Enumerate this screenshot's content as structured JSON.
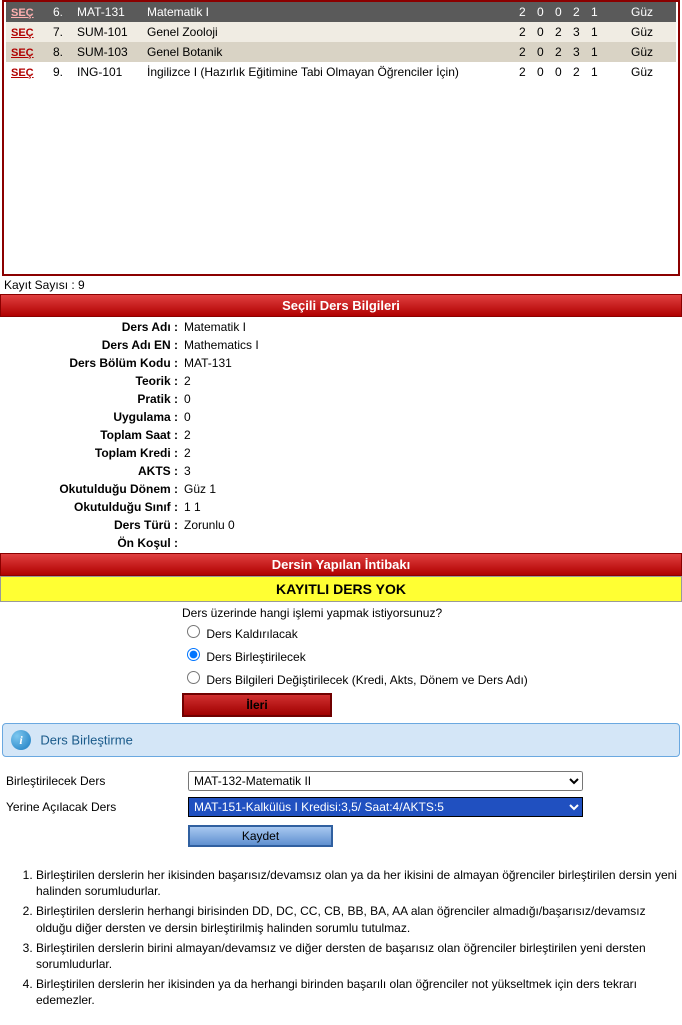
{
  "table": {
    "sel_label": "SEÇ",
    "header": {
      "no": "6.",
      "code": "MAT-131",
      "name": "Matematik I",
      "c1": "2",
      "c2": "0",
      "c3": "0",
      "c4": "2",
      "c5": "1",
      "term": "Güz"
    },
    "rows": [
      {
        "no": "7.",
        "code": "SUM-101",
        "name": "Genel Zooloji",
        "c1": "2",
        "c2": "0",
        "c3": "2",
        "c4": "3",
        "c5": "1",
        "term": "Güz",
        "cls": "row-light"
      },
      {
        "no": "8.",
        "code": "SUM-103",
        "name": "Genel Botanik",
        "c1": "2",
        "c2": "0",
        "c3": "2",
        "c4": "3",
        "c5": "1",
        "term": "Güz",
        "cls": "row-dark"
      },
      {
        "no": "9.",
        "code": "ING-101",
        "name": "İngilizce I (Hazırlık Eğitimine Tabi Olmayan Öğrenciler İçin)",
        "c1": "2",
        "c2": "0",
        "c3": "0",
        "c4": "2",
        "c5": "1",
        "term": "Güz",
        "cls": "row-white"
      }
    ]
  },
  "record_count": "Kayıt Sayısı : 9",
  "section1_title": "Seçili Ders Bilgileri",
  "details": [
    {
      "label": "Ders Adı :",
      "value": "Matematik I"
    },
    {
      "label": "Ders Adı EN :",
      "value": "Mathematics I"
    },
    {
      "label": "Ders Bölüm Kodu :",
      "value": "MAT-131"
    },
    {
      "label": "Teorik :",
      "value": "2"
    },
    {
      "label": "Pratik :",
      "value": "0"
    },
    {
      "label": "Uygulama :",
      "value": "0"
    },
    {
      "label": "Toplam Saat :",
      "value": "2"
    },
    {
      "label": "Toplam Kredi :",
      "value": "2"
    },
    {
      "label": "AKTS :",
      "value": "3"
    },
    {
      "label": "Okutulduğu Dönem :",
      "value": "Güz 1"
    },
    {
      "label": "Okutulduğu Sınıf :",
      "value": "1 1"
    },
    {
      "label": "Ders Türü :",
      "value": "Zorunlu 0"
    },
    {
      "label": "Ön Koşul :",
      "value": ""
    }
  ],
  "section2_title": "Dersin Yapılan İntibakı",
  "yellow_msg": "KAYITLI DERS YOK",
  "question": "Ders üzerinde hangi işlemi yapmak istiyorsunuz?",
  "radios": {
    "r1": "Ders Kaldırılacak",
    "r2": "Ders Birleştirilecek",
    "r3": "Ders Bilgileri Değiştirilecek (Kredi, Akts, Dönem ve Ders Adı)"
  },
  "btn_next": "İleri",
  "info_title": "Ders Birleştirme",
  "merge": {
    "label1": "Birleştirilecek Ders",
    "option1": "MAT-132-Matematik II",
    "label2": "Yerine Açılacak Ders",
    "option2": "MAT-151-Kalkülüs I Kredisi:3,5/ Saat:4/AKTS:5",
    "btn_save": "Kaydet"
  },
  "notes": [
    "Birleştirilen derslerin her ikisinden başarısız/devamsız olan ya da her ikisini de almayan öğrenciler birleştirilen dersin yeni halinden sorumludurlar.",
    "Birleştirilen derslerin herhangi birisinden DD, DC, CC, CB, BB, BA, AA alan öğrenciler almadığı/başarısız/devamsız olduğu diğer dersten ve dersin birleştirilmiş halinden sorumlu tutulmaz.",
    "Birleştirilen derslerin birini almayan/devamsız ve diğer dersten de başarısız olan öğrenciler birleştirilen yeni dersten sorumludurlar.",
    "Birleştirilen derslerin her ikisinden ya da herhangi birinden başarılı olan öğrenciler not yükseltmek için ders tekrarı edemezler."
  ]
}
